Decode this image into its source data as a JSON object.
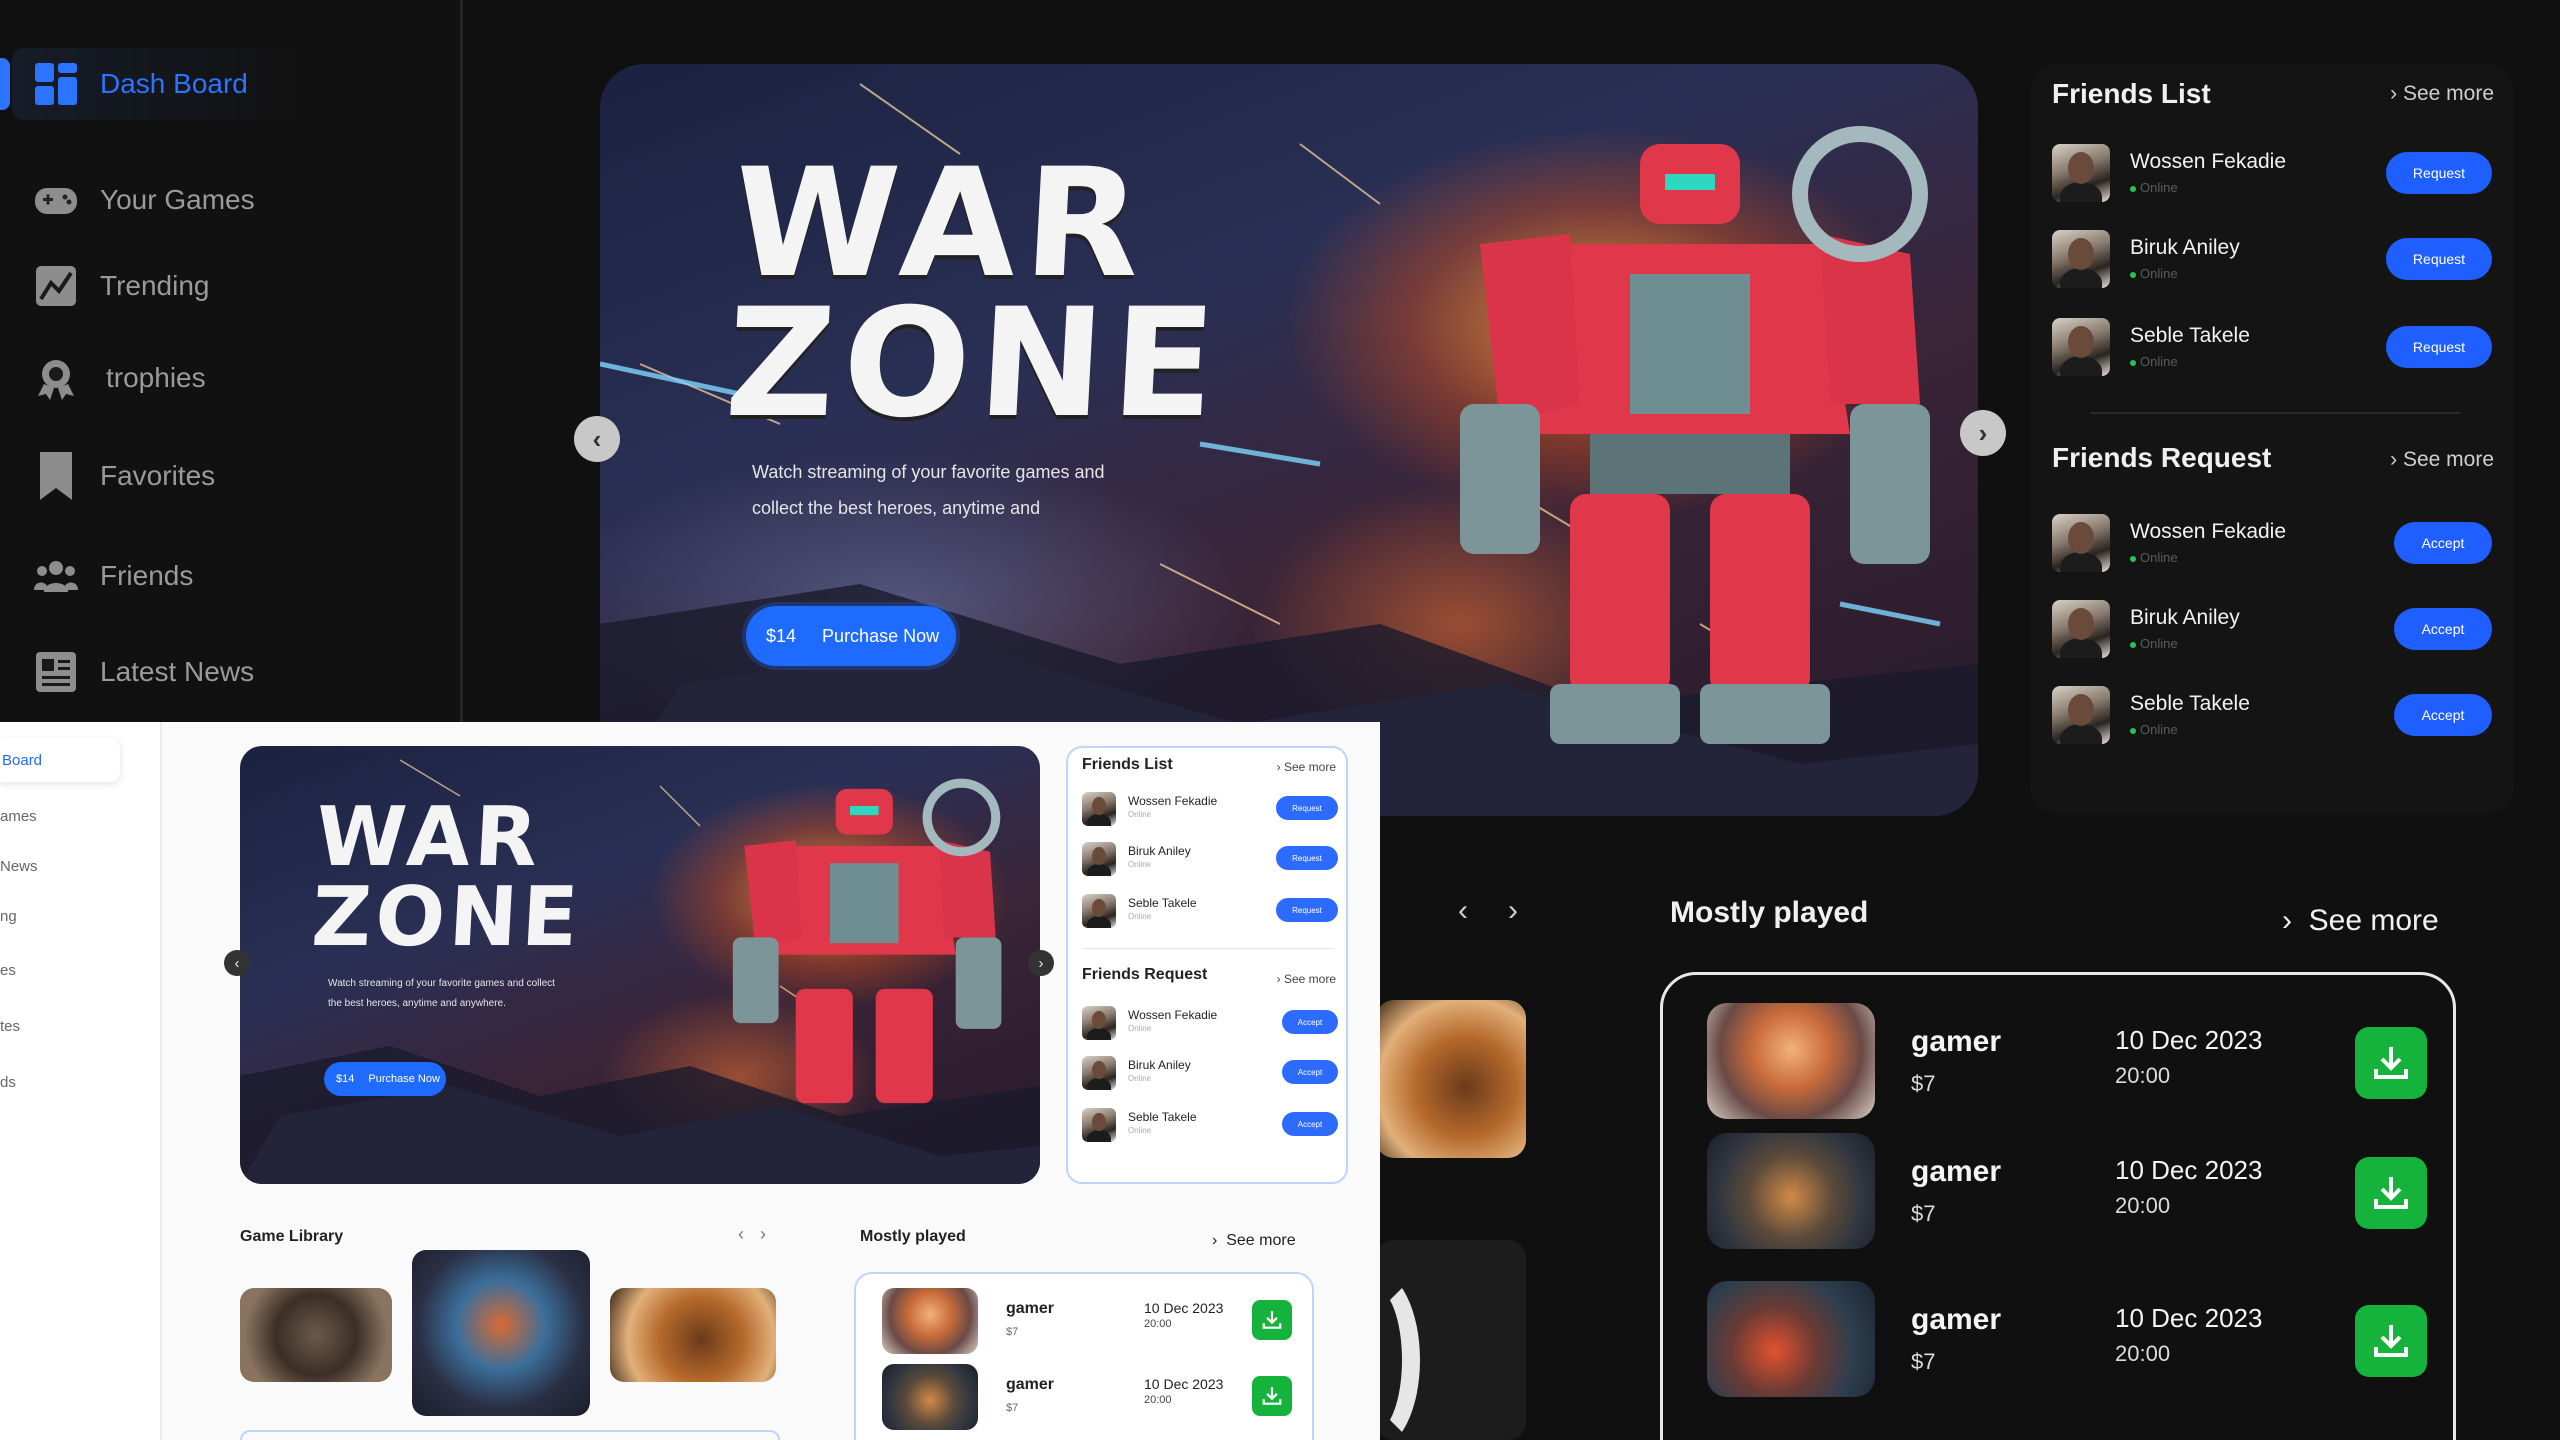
{
  "sidebar": {
    "items": [
      {
        "label": "Dash Board",
        "icon": "dashboard-grid-icon",
        "active": true
      },
      {
        "label": "Your Games",
        "icon": "gamepad-icon"
      },
      {
        "label": "Trending",
        "icon": "trending-chart-icon"
      },
      {
        "label": "trophies",
        "icon": "trophy-badge-icon"
      },
      {
        "label": "Favorites",
        "icon": "bookmark-icon"
      },
      {
        "label": "Friends",
        "icon": "friends-icon"
      },
      {
        "label": "Latest News",
        "icon": "newspaper-icon"
      }
    ]
  },
  "hero": {
    "title_line1": "WAR",
    "title_line2": "ZONE",
    "description": "Watch streaming of your favorite games and collect the best heroes, anytime and",
    "description_full": "Watch streaming of your favorite games and collect the best heroes, anytime and anywhere.",
    "price": "$14",
    "cta": "Purchase Now"
  },
  "friends_list": {
    "title": "Friends List",
    "see_more": "See more",
    "friends": [
      {
        "name": "Wossen Fekadie",
        "status": "Online",
        "action": "Request"
      },
      {
        "name": "Biruk Aniley",
        "status": "Online",
        "action": "Request"
      },
      {
        "name": "Seble Takele",
        "status": "Online",
        "action": "Request"
      }
    ]
  },
  "friends_request": {
    "title": "Friends Request",
    "see_more": "See more",
    "friends": [
      {
        "name": "Wossen Fekadie",
        "status": "Online",
        "action": "Accept"
      },
      {
        "name": "Biruk Aniley",
        "status": "Online",
        "action": "Accept"
      },
      {
        "name": "Seble Takele",
        "status": "Online",
        "action": "Accept"
      }
    ]
  },
  "mostly_played": {
    "title": "Mostly played",
    "see_more": "See more",
    "games": [
      {
        "name": "gamer",
        "price": "$7",
        "date": "10 Dec 2023",
        "time": "20:00"
      },
      {
        "name": "gamer",
        "price": "$7",
        "date": "10 Dec 2023",
        "time": "20:00"
      },
      {
        "name": "gamer",
        "price": "$7",
        "date": "10 Dec 2023",
        "time": "20:00"
      }
    ]
  },
  "light_sidebar": {
    "items": [
      "Board",
      "ames",
      "News",
      "ng",
      "es",
      "tes",
      "ds"
    ]
  },
  "game_library": {
    "title": "Game Library"
  },
  "colors": {
    "accent": "#1f6bff",
    "download": "#16b33c",
    "dark_bg": "#101010",
    "light_bg": "#fafafa"
  }
}
